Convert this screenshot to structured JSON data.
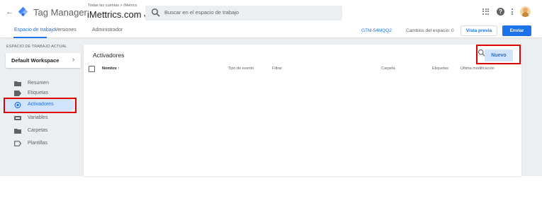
{
  "header": {
    "app_title": "Tag Manager",
    "account_breadcrumb": "Todas las cuentas > iMetrics",
    "account_name": "iMettrics.com",
    "search_placeholder": "Buscar en el espacio de trabajo"
  },
  "subnav": {
    "tabs": [
      {
        "label": "Espacio de trabajo",
        "active": true
      },
      {
        "label": "Versiones",
        "active": false
      },
      {
        "label": "Administrador",
        "active": false
      }
    ],
    "container_id": "GTM-54MQQ2",
    "changes_text": "Cambios del espacio: 0",
    "preview_label": "Vista previa",
    "submit_label": "Enviar"
  },
  "sidebar": {
    "workspace_section_label": "ESPACIO DE TRABAJO ACTUAL",
    "workspace_name": "Default Workspace",
    "items": [
      {
        "label": "Resumen",
        "icon": "folder-icon",
        "active": false
      },
      {
        "label": "Etiquetas",
        "icon": "tag-icon",
        "active": false
      },
      {
        "label": "Activadores",
        "icon": "trigger-icon",
        "active": true
      },
      {
        "label": "Variables",
        "icon": "variables-icon",
        "active": false
      },
      {
        "label": "Carpetas",
        "icon": "folder-icon",
        "active": false
      },
      {
        "label": "Plantillas",
        "icon": "template-icon",
        "active": false
      }
    ]
  },
  "main": {
    "title": "Activadores",
    "new_button_label": "Nuevo",
    "columns": [
      {
        "label": "Nombre ↑"
      },
      {
        "label": "Tipo de evento"
      },
      {
        "label": "Filtrar"
      },
      {
        "label": "Carpeta"
      },
      {
        "label": "Etiquetas"
      },
      {
        "label": "Última modificación"
      }
    ]
  },
  "colors": {
    "accent": "#1a73e8",
    "highlight": "#e00000",
    "active_bg": "#d2e3fc",
    "page_bg": "#eceff1"
  }
}
